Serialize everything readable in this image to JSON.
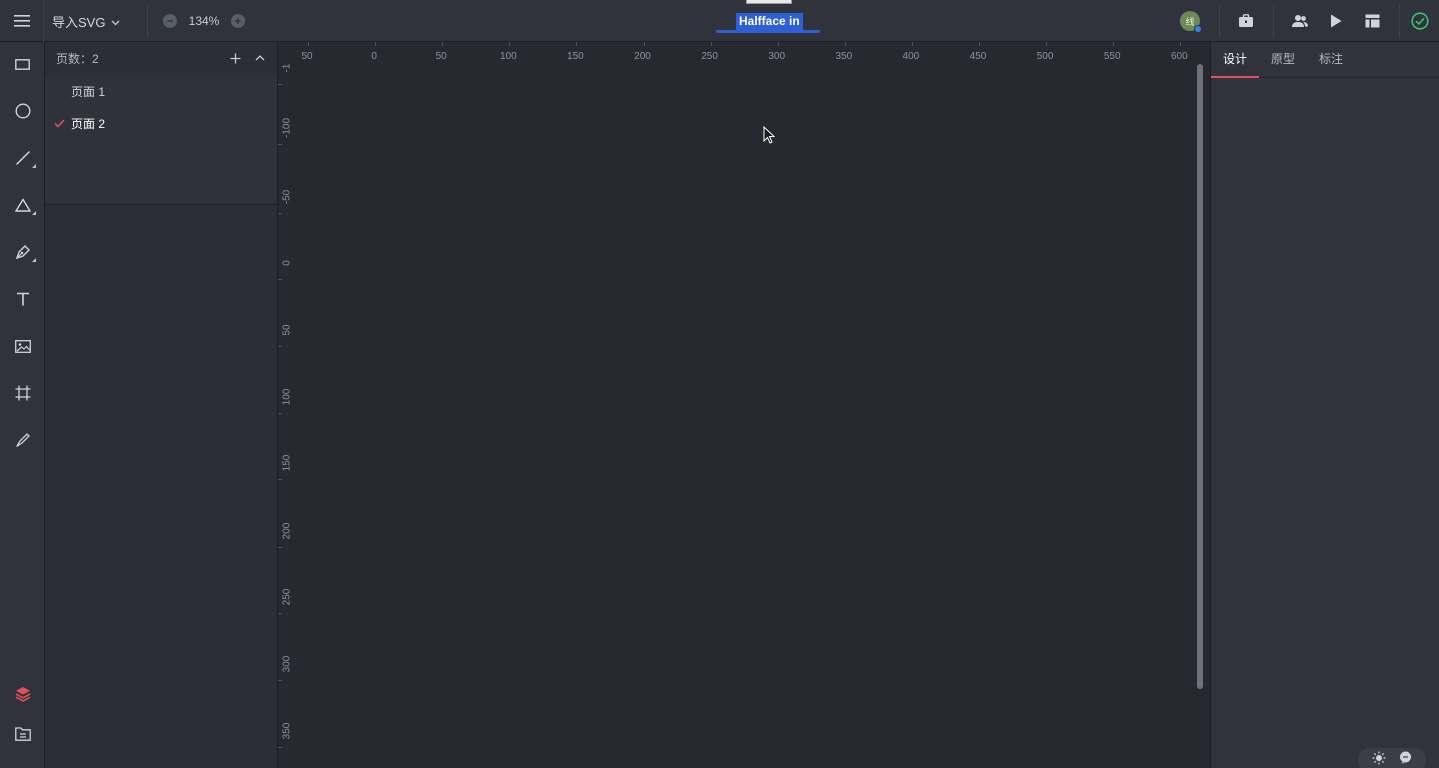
{
  "topbar": {
    "import_label": "导入SVG",
    "zoom_value": "134%",
    "doc_title": "Halfface in",
    "avatar_initial": "线"
  },
  "pages": {
    "count_label": "页数：2",
    "items": [
      {
        "label": "页面 1",
        "active": false
      },
      {
        "label": "页面 2",
        "active": true
      }
    ]
  },
  "right_panel": {
    "tabs": [
      {
        "label": "设计",
        "active": true
      },
      {
        "label": "原型",
        "active": false
      },
      {
        "label": "标注",
        "active": false
      }
    ]
  },
  "ruler": {
    "top_labels": [
      "50",
      "0",
      "50",
      "100",
      "150",
      "200",
      "250",
      "300",
      "350",
      "400",
      "450",
      "500",
      "550",
      "600"
    ],
    "left_labels": [
      "-1",
      "-100",
      "-50",
      "0",
      "50",
      "100",
      "150",
      "200",
      "250",
      "300",
      "350"
    ]
  },
  "colors": {
    "accent": "#e0505c",
    "highlight": "#2f5fd6",
    "success": "#3cc16a",
    "background": "#262930",
    "panel": "#30333c"
  },
  "icons": {
    "toolbar": [
      "rectangle-icon",
      "ellipse-icon",
      "line-icon",
      "triangle-icon",
      "pen-icon",
      "text-icon",
      "image-icon",
      "artboard-icon",
      "slice-icon",
      "layers-icon",
      "assets-icon"
    ],
    "topbar_right": [
      "toolbox-icon",
      "team-icon",
      "play-icon",
      "layout-icon",
      "saved-check-icon"
    ]
  }
}
